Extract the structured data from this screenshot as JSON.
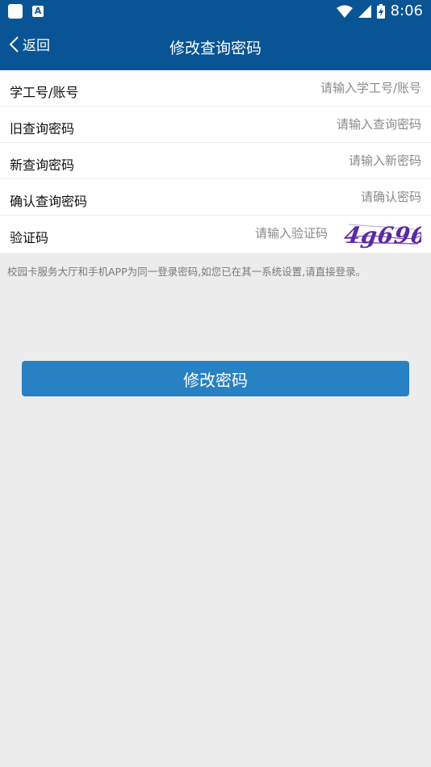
{
  "status_bar": {
    "time": "8:06",
    "notification_icons": [
      "app-icon",
      "a-icon"
    ],
    "status_icons": [
      "wifi-icon",
      "signal-icon",
      "battery-charging-icon"
    ]
  },
  "header": {
    "back_label": "返回",
    "title": "修改查询密码"
  },
  "form": {
    "fields": [
      {
        "label": "学工号/账号",
        "placeholder": "请输入学工号/账号"
      },
      {
        "label": "旧查询密码",
        "placeholder": "请输入查询密码"
      },
      {
        "label": "新查询密码",
        "placeholder": "请输入新密码"
      },
      {
        "label": "确认查询密码",
        "placeholder": "请确认密码"
      },
      {
        "label": "验证码",
        "placeholder": "请输入验证码"
      }
    ],
    "captcha_text": "4g696"
  },
  "note": "校园卡服务大厅和手机APP为同一登录密码,如您已在其一系统设置,请直接登录。",
  "submit_label": "修改密码",
  "colors": {
    "header": "#085494",
    "button": "#2781c3",
    "background": "#ececec"
  }
}
